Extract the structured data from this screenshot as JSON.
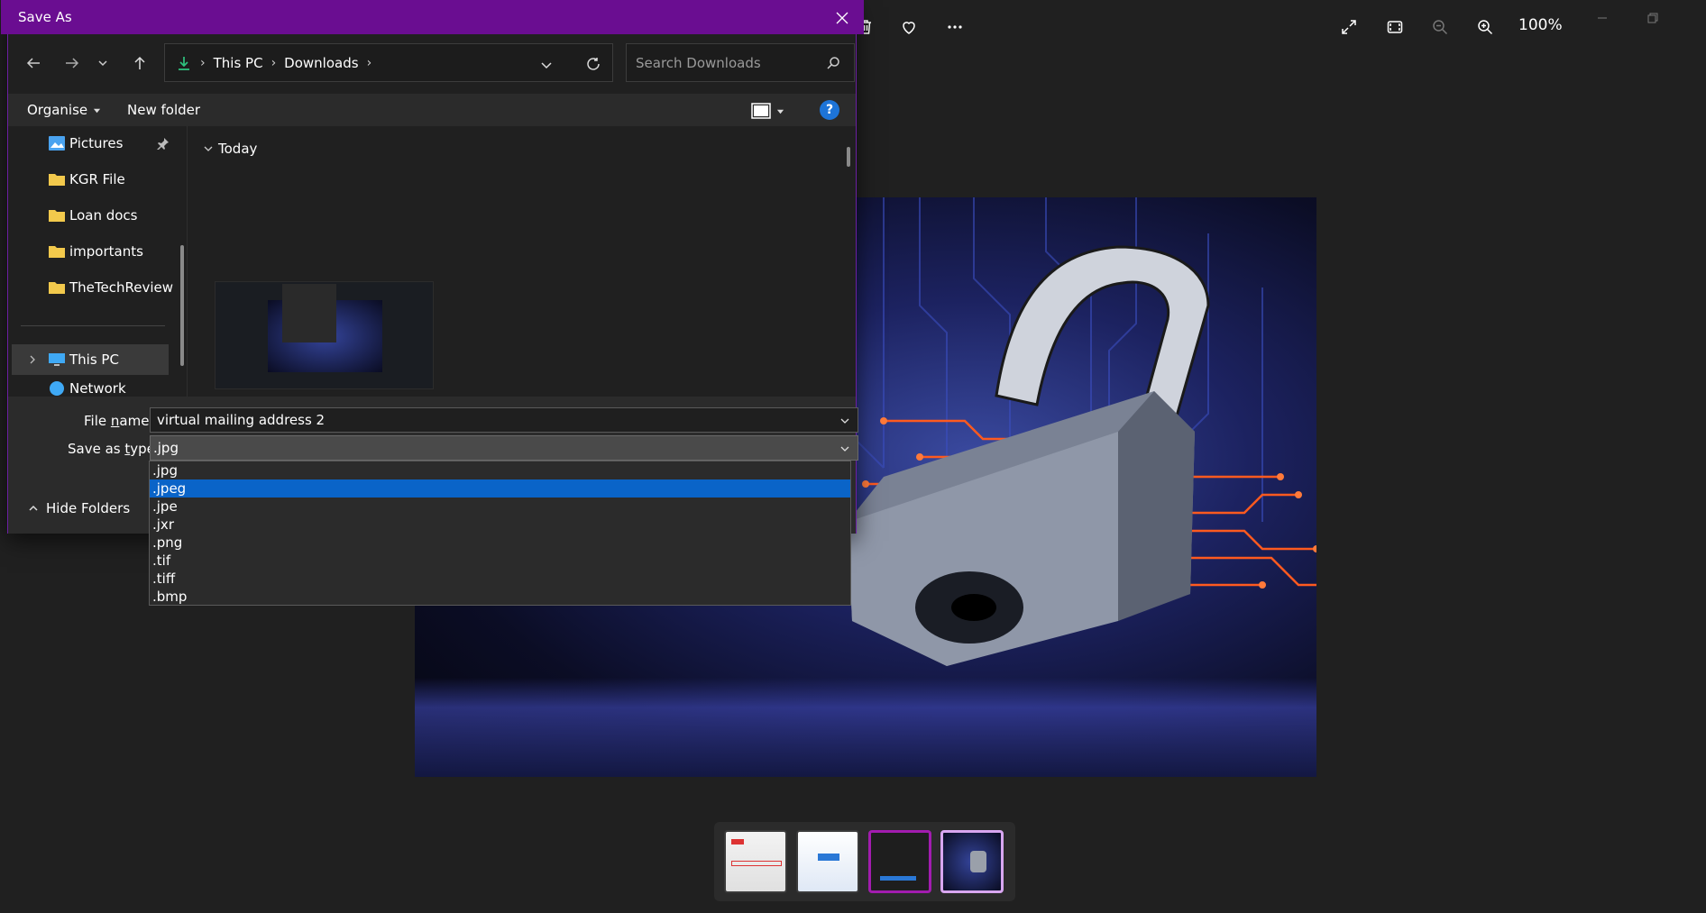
{
  "photos_app": {
    "zoom_level": "100%"
  },
  "dialog": {
    "title": "Save As",
    "address": {
      "crumbs": [
        "This PC",
        "Downloads"
      ]
    },
    "search_placeholder": "Search Downloads",
    "toolbar": {
      "organise_label": "Organise",
      "new_folder_label": "New folder",
      "help_label": "?"
    },
    "nav_pane": {
      "items": [
        {
          "label": "Pictures",
          "icon": "pictures-icon",
          "pinned": true
        },
        {
          "label": "KGR File",
          "icon": "folder-icon"
        },
        {
          "label": "Loan docs",
          "icon": "folder-icon"
        },
        {
          "label": "importants",
          "icon": "folder-icon"
        },
        {
          "label": "TheTechReview",
          "icon": "folder-icon"
        },
        {
          "label": "This PC",
          "icon": "this-pc-icon"
        },
        {
          "label": "Network",
          "icon": "network-icon"
        }
      ]
    },
    "file_view": {
      "group_label": "Today"
    },
    "file_name": {
      "label_prefix": "File ",
      "label_underlined": "n",
      "label_suffix": "ame:",
      "value": "virtual mailing address 2"
    },
    "save_as_type": {
      "label_prefix": "Save as ",
      "label_underlined": "t",
      "label_suffix": "ype:",
      "value": ".jpg",
      "options": [
        ".jpg",
        ".jpeg",
        ".jpe",
        ".jxr",
        ".png",
        ".tif",
        ".tiff",
        ".bmp"
      ],
      "highlighted_index": 1
    },
    "hide_folders_label": "Hide Folders"
  },
  "colors": {
    "dialog_titlebar": "#6a0d91",
    "selection_blue": "#0a64c8",
    "help_blue": "#1d74d8"
  }
}
